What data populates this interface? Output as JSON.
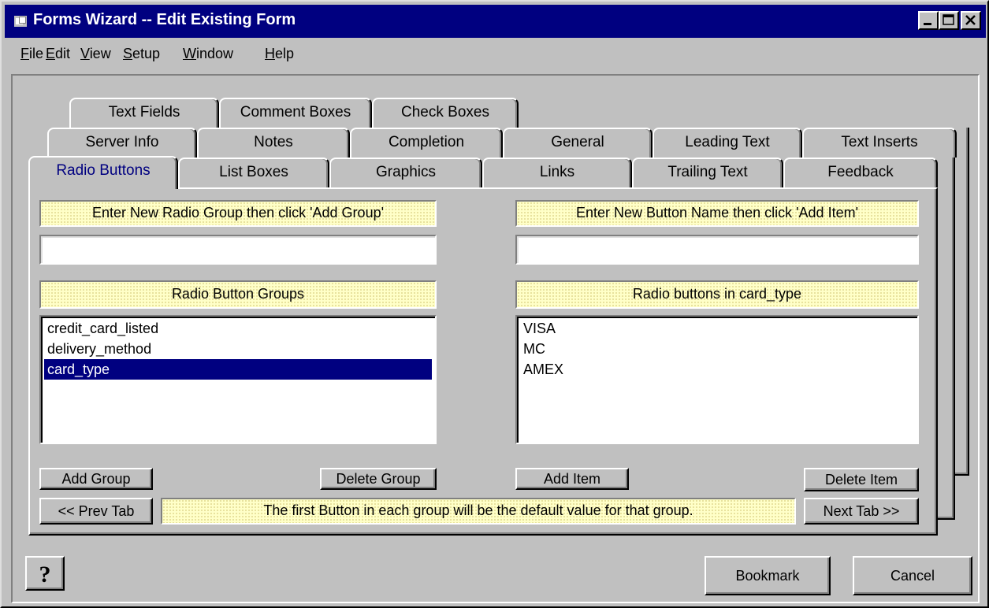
{
  "window": {
    "title": "Forms Wizard -- Edit Existing Form"
  },
  "menu": [
    {
      "pre": "",
      "u": "F",
      "post": "ile"
    },
    {
      "pre": "",
      "u": "E",
      "post": "dit"
    },
    {
      "pre": "",
      "u": "V",
      "post": "iew"
    },
    {
      "pre": "",
      "u": "S",
      "post": "etup"
    },
    {
      "pre": "",
      "u": "W",
      "post": "indow"
    },
    {
      "pre": "",
      "u": "H",
      "post": "elp"
    }
  ],
  "tabs": {
    "row1": [
      "Text Fields",
      "Comment Boxes",
      "Check Boxes"
    ],
    "row2": [
      "Server Info",
      "Notes",
      "Completion",
      "General",
      "Leading Text",
      "Text Inserts"
    ],
    "row3": [
      "Radio Buttons",
      "List Boxes",
      "Graphics",
      "Links",
      "Trailing Text",
      "Feedback"
    ]
  },
  "radio": {
    "group_prompt": "Enter New Radio Group then click 'Add Group'",
    "group_input_value": "",
    "button_prompt": "Enter New Button Name then click 'Add Item'",
    "button_input_value": "",
    "groups_header": "Radio Button Groups",
    "buttons_header": "Radio buttons in card_type",
    "groups": [
      "credit_card_listed",
      "delivery_method",
      "card_type"
    ],
    "selected_group": "card_type",
    "buttons": [
      "VISA",
      "MC",
      "AMEX"
    ],
    "add_group": "Add Group",
    "delete_group": "Delete Group",
    "add_item": "Add Item",
    "delete_item": "Delete Item",
    "prev_tab": "<< Prev Tab",
    "next_tab": "Next Tab >>",
    "note": "The first Button in each group will be the default value for that group."
  },
  "footer": {
    "help_icon": "question-icon",
    "bookmark": "Bookmark",
    "cancel": "Cancel"
  },
  "colors": {
    "titlebar": "#000080",
    "face": "#c0c0c0",
    "selection": "#000080",
    "hint": "#ffffc8"
  }
}
